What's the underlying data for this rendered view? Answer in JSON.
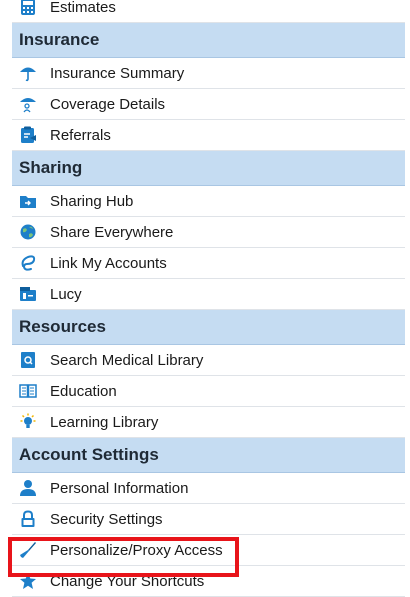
{
  "menu": {
    "top_partial": {
      "label": "Estimates",
      "icon": "calculator-icon"
    },
    "sections": [
      {
        "title": "Insurance",
        "items": [
          {
            "label": "Insurance Summary",
            "icon": "umbrella-icon"
          },
          {
            "label": "Coverage Details",
            "icon": "umbrella-person-icon"
          },
          {
            "label": "Referrals",
            "icon": "clipboard-icon"
          }
        ]
      },
      {
        "title": "Sharing",
        "items": [
          {
            "label": "Sharing Hub",
            "icon": "folder-share-icon"
          },
          {
            "label": "Share Everywhere",
            "icon": "globe-icon"
          },
          {
            "label": "Link My Accounts",
            "icon": "link-icon"
          },
          {
            "label": "Lucy",
            "icon": "lucy-icon"
          }
        ]
      },
      {
        "title": "Resources",
        "items": [
          {
            "label": "Search Medical Library",
            "icon": "library-search-icon"
          },
          {
            "label": "Education",
            "icon": "book-icon"
          },
          {
            "label": "Learning Library",
            "icon": "lightbulb-icon"
          }
        ]
      },
      {
        "title": "Account Settings",
        "items": [
          {
            "label": "Personal Information",
            "icon": "person-icon"
          },
          {
            "label": "Security Settings",
            "icon": "lock-icon"
          },
          {
            "label": "Personalize/Proxy Access",
            "icon": "brush-icon"
          },
          {
            "label": "Change Your Shortcuts",
            "icon": "star-icon"
          }
        ]
      }
    ]
  },
  "colors": {
    "header_bg": "#c5dcf2",
    "highlight_border": "#e8141a",
    "icon_blue": "#1e7fc9"
  }
}
